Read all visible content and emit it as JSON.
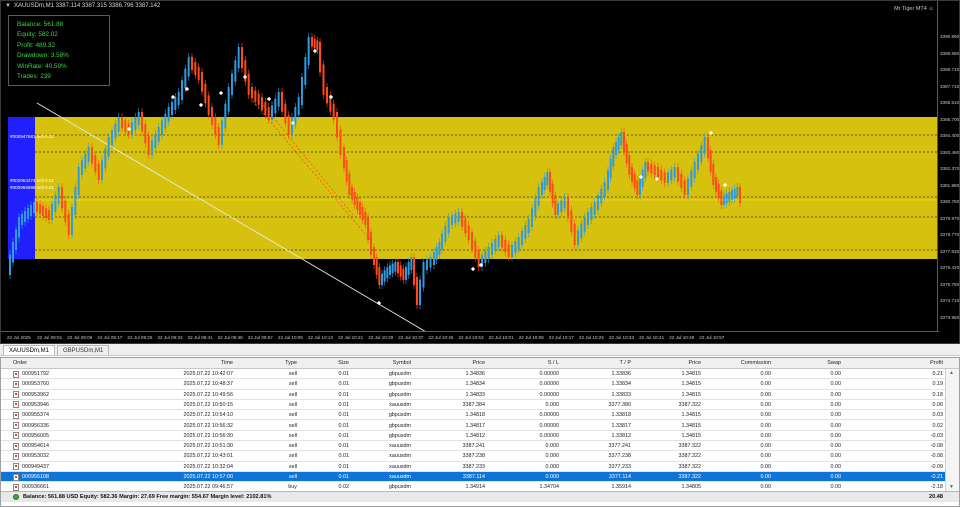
{
  "window": {
    "title": "XAUUSDm,M1  3387.114 3387.315 3386.796 3387.142",
    "ea_badge": "Mr Tiger MT4 ☺"
  },
  "stats": [
    "Balance: 561.88",
    "Equity: 582.02",
    "Profit: 489.32",
    "Drawdown: 3.58%",
    "WinRate: 40.59%",
    "Trades: 239"
  ],
  "price_axis": [
    "3390.890",
    "3389.680",
    "3388.710",
    "3387.710",
    "3386.610",
    "3385.700",
    "3384.400",
    "3383.460",
    "3382.370",
    "3381.880",
    "3380.760",
    "3379.970",
    "3378.770",
    "3377.630",
    "3376.420",
    "3375.750",
    "3374.710",
    "3373.960"
  ],
  "time_axis": [
    "22 Jul 2025",
    "22 Jul 09:01",
    "22 Jul 09:09",
    "22 Jul 09:17",
    "22 Jul 09:25",
    "22 Jul 09:33",
    "22 Jul 09:41",
    "22 Jul 09:49",
    "22 Jul 09:57",
    "22 Jul 10:05",
    "22 Jul 10:13",
    "22 Jul 10:21",
    "22 Jul 10:29",
    "22 Jul 10:37",
    "22 Jul 10:45",
    "22 Jul 10:53",
    "22 Jul 10:01",
    "22 Jul 10:09",
    "22 Jul 10:17",
    "22 Jul 10:25",
    "22 Jul 10:33",
    "22 Jul 10:41",
    "22 Jul 10:49",
    "22 Jul 10:57"
  ],
  "level_tags": [
    "#000947681 sell 0.01",
    "#000953374 sell 0.01",
    "#000955986 sell 0.01"
  ],
  "chart_tabs": [
    "XAUUSDm,M1",
    "GBPUSDm,M1"
  ],
  "colors": {
    "zone": "#d6c10e",
    "zone_left": "#2020ff",
    "bull": "#2f9ae0",
    "bear": "#ff4a1a",
    "selected": "#0f74d6"
  },
  "trade_table": {
    "columns": [
      "Order",
      "Time",
      "Type",
      "Size",
      "Symbol",
      "Price",
      "S / L",
      "T / P",
      "Price",
      "Commission",
      "Swap",
      "Profit"
    ],
    "rows": [
      [
        "000951792",
        "2025.07.22 10:42:07",
        "sell",
        "0.01",
        "gbpusdm",
        "1.34836",
        "0.00000",
        "1.33836",
        "1.34815",
        "0.00",
        "0.00",
        "0.21"
      ],
      [
        "000953760",
        "2025.07.22 10:48:37",
        "sell",
        "0.01",
        "gbpusdm",
        "1.34834",
        "0.00000",
        "1.33834",
        "1.34815",
        "0.00",
        "0.00",
        "0.19"
      ],
      [
        "000953962",
        "2025.07.22 10:49:56",
        "sell",
        "0.01",
        "gbpusdm",
        "1.34833",
        "0.00000",
        "1.33833",
        "1.34815",
        "0.00",
        "0.00",
        "0.18"
      ],
      [
        "000953946",
        "2025.07.22 10:50:15",
        "sell",
        "0.01",
        "xauusdm",
        "3387.384",
        "0.000",
        "3377.380",
        "3387.322",
        "0.00",
        "0.00",
        "0.06"
      ],
      [
        "000955374",
        "2025.07.22 10:54:10",
        "sell",
        "0.01",
        "gbpusdm",
        "1.34818",
        "0.00000",
        "1.33818",
        "1.34815",
        "0.00",
        "0.00",
        "0.03"
      ],
      [
        "000956336",
        "2025.07.22 10:56:32",
        "sell",
        "0.01",
        "gbpusdm",
        "1.34817",
        "0.00000",
        "1.33817",
        "1.34815",
        "0.00",
        "0.00",
        "0.02"
      ],
      [
        "000956005",
        "2025.07.22 10:56:30",
        "sell",
        "0.01",
        "gbpusdm",
        "1.34812",
        "0.00000",
        "1.33812",
        "1.34815",
        "0.00",
        "0.00",
        "-0.03"
      ],
      [
        "000954614",
        "2025.07.22 10:51:30",
        "sell",
        "0.01",
        "xauusdm",
        "3387.241",
        "0.000",
        "3377.241",
        "3387.322",
        "0.00",
        "0.00",
        "-0.08"
      ],
      [
        "000953032",
        "2025.07.22 10:43:01",
        "sell",
        "0.01",
        "xauusdm",
        "3387.238",
        "0.000",
        "3377.238",
        "3387.322",
        "0.00",
        "0.00",
        "-0.08"
      ],
      [
        "000949437",
        "2025.07.22 10:32:04",
        "sell",
        "0.01",
        "xauusdm",
        "3387.233",
        "0.000",
        "3377.233",
        "3387.322",
        "0.00",
        "0.00",
        "-0.09"
      ],
      [
        "000956108",
        "2025.07.22 10:57:00",
        "sell",
        "0.01",
        "xauusdm",
        "3387.114",
        "0.000",
        "3377.114",
        "3387.322",
        "0.00",
        "0.00",
        "-0.21"
      ],
      [
        "000936661",
        "2025.07.22 09:46:57",
        "buy",
        "0.02",
        "gbpusdm",
        "1.34914",
        "1.34704",
        "1.35914",
        "1.34805",
        "0.00",
        "0.00",
        "-2.18"
      ]
    ],
    "selected_index": 10
  },
  "balance_bar": {
    "text": "Balance: 561.88 USD  Equity: 582.36  Margin: 27.69  Free margin: 554.67  Margin level: 2102.81%",
    "profit": "20.48"
  }
}
